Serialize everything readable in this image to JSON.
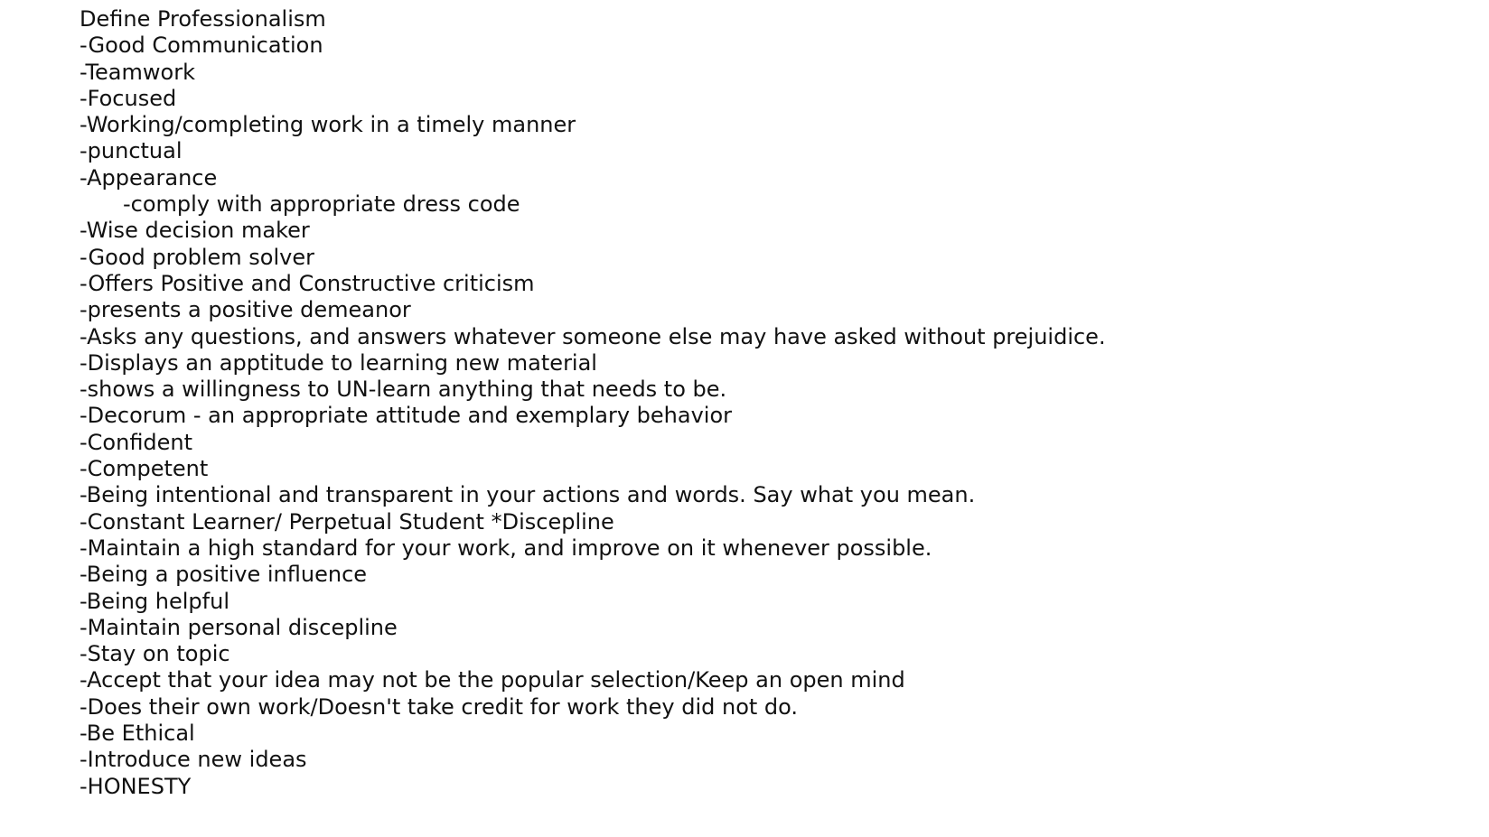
{
  "document": {
    "title": "Define Professionalism",
    "items": [
      "-Good Communication",
      "-Teamwork",
      "-Focused",
      "-Working/completing work in a timely manner",
      "-punctual",
      "-Appearance",
      "-comply with appropriate dress code",
      "-Wise decision maker",
      "-Good problem solver",
      "-Offers Positive and Constructive criticism",
      "-presents a positive demeanor",
      "-Asks any questions, and answers whatever someone else may have asked without prejuidice.",
      "-Displays an apptitude to learning new material",
      "-shows a willingness to UN-learn anything that needs to be.",
      "-Decorum - an appropriate attitude and exemplary behavior",
      "-Confident",
      "-Competent",
      "-Being intentional and transparent in your actions and words. Say what you mean.",
      "-Constant Learner/ Perpetual Student *Discepline",
      "-Maintain a high standard for your work, and improve on it whenever possible.",
      "-Being a positive influence",
      "-Being helpful",
      "-Maintain personal discepline",
      "-Stay on topic",
      "-Accept that your idea may not be the popular selection/Keep an open mind",
      "-Does their own work/Doesn't take credit for work they did not do.",
      "-Be Ethical",
      "-Introduce new ideas",
      "-HONESTY"
    ]
  }
}
